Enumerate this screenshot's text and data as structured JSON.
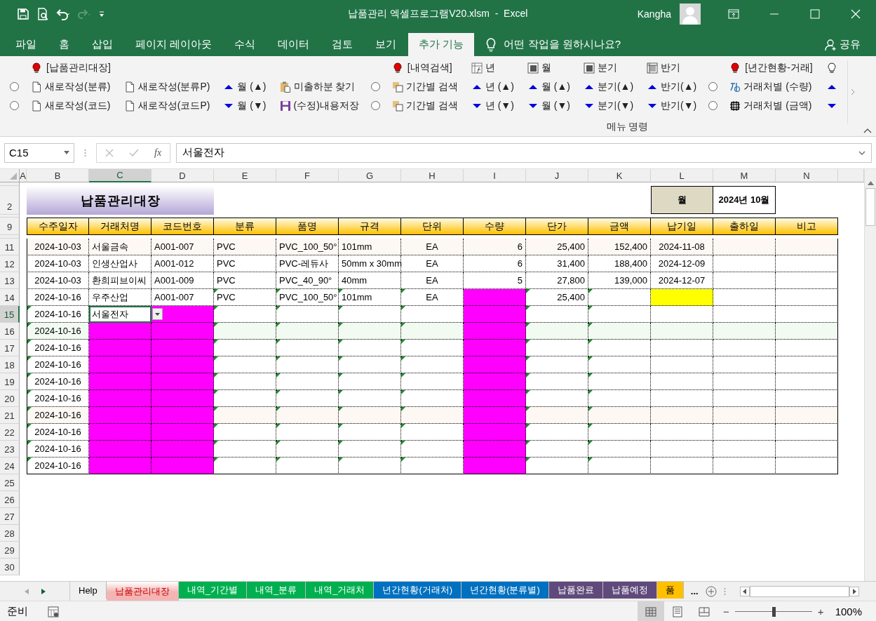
{
  "title_bar": {
    "title": "납품관리 엑셀프로그램V20.xlsm  -  Excel",
    "user": "Kangha"
  },
  "menu_tabs": [
    {
      "label": "파일",
      "selected": false
    },
    {
      "label": "홈",
      "selected": false
    },
    {
      "label": "삽입",
      "selected": false
    },
    {
      "label": "페이지 레이아웃",
      "selected": false
    },
    {
      "label": "수식",
      "selected": false
    },
    {
      "label": "데이터",
      "selected": false
    },
    {
      "label": "검토",
      "selected": false
    },
    {
      "label": "보기",
      "selected": false
    },
    {
      "label": "추가 기능",
      "selected": true
    }
  ],
  "tell_me": "어떤 작업을 원하시나요?",
  "share": "공유",
  "ribbon": {
    "columns": [
      {
        "middle": {
          "kind": "radio",
          "checked": false
        },
        "bottom": {
          "kind": "radio",
          "checked": false
        }
      },
      {
        "top": {
          "kind": "header",
          "text": "[납품관리대장]"
        },
        "middle": {
          "kind": "command",
          "text": "새로작성(분류)"
        },
        "bottom": {
          "kind": "command",
          "text": "새로작성(코드)"
        }
      },
      {
        "middle": {
          "kind": "command",
          "text": "새로작성(분류P)"
        },
        "bottom": {
          "kind": "command",
          "text": "새로작성(코드P)"
        }
      },
      {
        "middle": {
          "kind": "command",
          "text": "월 (▲)"
        },
        "bottom": {
          "kind": "command",
          "text": "월 (▼)"
        }
      },
      {
        "middle": {
          "kind": "command",
          "text": "미출하분 찾기"
        },
        "bottom": {
          "kind": "command",
          "text": "(수정)내용저장"
        }
      },
      {
        "middle": {
          "kind": "radio",
          "checked": false
        },
        "bottom": {
          "kind": "radio",
          "checked": false
        }
      },
      {
        "top": {
          "kind": "header",
          "text": "[내역검색]"
        },
        "middle": {
          "kind": "command",
          "text": "기간별 검색"
        },
        "bottom": {
          "kind": "command",
          "text": "기간별 검색"
        }
      },
      {
        "top": {
          "kind": "command",
          "text": "년"
        },
        "middle": {
          "kind": "command",
          "text": "년 (▲)"
        },
        "bottom": {
          "kind": "command",
          "text": "년 (▼)"
        }
      },
      {
        "top": {
          "kind": "command",
          "text": "월"
        },
        "middle": {
          "kind": "command",
          "text": "월 (▲)"
        },
        "bottom": {
          "kind": "command",
          "text": "월 (▼)"
        }
      },
      {
        "top": {
          "kind": "command",
          "text": "분기"
        },
        "middle": {
          "kind": "command",
          "text": "분기(▲)"
        },
        "bottom": {
          "kind": "command",
          "text": "분기(▼)"
        }
      },
      {
        "top": {
          "kind": "command",
          "text": "반기"
        },
        "middle": {
          "kind": "command",
          "text": "반기(▲)"
        },
        "bottom": {
          "kind": "command",
          "text": "반기(▼)"
        }
      },
      {
        "middle": {
          "kind": "radio",
          "checked": false
        },
        "bottom": {
          "kind": "radio",
          "checked": false
        }
      },
      {
        "top": {
          "kind": "header",
          "text": "[년간현황-거래]"
        },
        "middle": {
          "kind": "command",
          "text": "거래처별 (수량)"
        },
        "bottom": {
          "kind": "command",
          "text": "거래처별 (금액)"
        }
      },
      {
        "top": {
          "kind": "command"
        },
        "middle": {
          "kind": "command"
        },
        "bottom": {
          "kind": "command"
        }
      }
    ],
    "group_label": "메뉴 명령"
  },
  "formula_bar": {
    "name_box": "C15",
    "function_button": "fx",
    "value": "서울전자"
  },
  "sheet": {
    "column_letters": [
      {
        "label": "A",
        "selected": false
      },
      {
        "label": "B",
        "selected": false
      },
      {
        "label": "C",
        "selected": true
      },
      {
        "label": "D",
        "selected": false
      },
      {
        "label": "E",
        "selected": false
      },
      {
        "label": "F",
        "selected": false
      },
      {
        "label": "G",
        "selected": false
      },
      {
        "label": "H",
        "selected": false
      },
      {
        "label": "I",
        "selected": false
      },
      {
        "label": "J",
        "selected": false
      },
      {
        "label": "K",
        "selected": false
      },
      {
        "label": "L",
        "selected": false
      },
      {
        "label": "M",
        "selected": false
      },
      {
        "label": "N",
        "selected": false
      }
    ],
    "title_row": "2",
    "title": "납품관리대장",
    "period": {
      "label": "월",
      "value": "2024년 10월"
    },
    "header_row": "9",
    "headers": [
      "수주일자",
      "거래처명",
      "코드번호",
      "분류",
      "품명",
      "규격",
      "단위",
      "수량",
      "단가",
      "금액",
      "납기일",
      "출하일",
      "비고"
    ],
    "rows": [
      {
        "number": "11",
        "selected": false,
        "color": "#fdf8f3",
        "cells": [
          {
            "text": "2024-10-03"
          },
          {
            "text": "서울금속"
          },
          {
            "text": "A001-007"
          },
          {
            "text": "PVC"
          },
          {
            "text": "PVC_100_50°"
          },
          {
            "text": "101mm"
          },
          {
            "text": "EA"
          },
          {
            "text": "6"
          },
          {
            "text": "25,400"
          },
          {
            "text": "152,400"
          },
          {
            "text": "2024-11-08"
          },
          {},
          {}
        ]
      },
      {
        "number": "12",
        "selected": false,
        "cells": [
          {
            "text": "2024-10-03"
          },
          {
            "text": "인생산업사"
          },
          {
            "text": "A001-012"
          },
          {
            "text": "PVC"
          },
          {
            "text": "PVC-레듀사"
          },
          {
            "text": "50mm x 30mm"
          },
          {
            "text": "EA"
          },
          {
            "text": "6"
          },
          {
            "text": "31,400"
          },
          {
            "text": "188,400"
          },
          {
            "text": "2024-12-09"
          },
          {},
          {}
        ]
      },
      {
        "number": "13",
        "selected": false,
        "cells": [
          {
            "text": "2024-10-03"
          },
          {
            "text": "환희피브이씨"
          },
          {
            "text": "A001-009"
          },
          {
            "text": "PVC"
          },
          {
            "text": "PVC_40_90°"
          },
          {
            "text": "40mm"
          },
          {
            "text": "EA"
          },
          {
            "text": "5"
          },
          {
            "text": "27,800"
          },
          {
            "text": "139,000"
          },
          {
            "text": "2024-12-07"
          },
          {},
          {}
        ]
      },
      {
        "number": "14",
        "selected": false,
        "cells": [
          {
            "text": "2024-10-16"
          },
          {
            "text": "우주산업"
          },
          {
            "text": "A001-007"
          },
          {
            "text": "PVC",
            "flag": true
          },
          {
            "text": "PVC_100_50°",
            "flag": true
          },
          {
            "text": "101mm",
            "flag": true
          },
          {
            "text": "EA",
            "flag": true
          },
          {
            "color": "#ff00ff"
          },
          {
            "text": "25,400",
            "flag": true
          },
          {
            "flag": true
          },
          {
            "color": "#ffff00"
          },
          {},
          {}
        ]
      },
      {
        "number": "15",
        "selected": true,
        "cells": [
          {
            "text": "2024-10-16",
            "flag": true
          },
          {
            "text": "서울전자"
          },
          {
            "color": "#ff00ff"
          },
          {
            "flag": true
          },
          {
            "flag": true
          },
          {
            "flag": true
          },
          {
            "flag": true
          },
          {
            "color": "#ff00ff"
          },
          {
            "flag": true
          },
          {
            "flag": true
          },
          {},
          {},
          {}
        ]
      },
      {
        "number": "16",
        "selected": false,
        "color": "#f2fbf2",
        "cells": [
          {
            "text": "2024-10-16",
            "flag": true
          },
          {
            "color": "#ff00ff"
          },
          {
            "color": "#ff00ff"
          },
          {
            "flag": true
          },
          {
            "flag": true
          },
          {
            "flag": true
          },
          {
            "flag": true
          },
          {
            "color": "#ff00ff"
          },
          {
            "flag": true
          },
          {
            "flag": true
          },
          {},
          {},
          {}
        ]
      },
      {
        "number": "17",
        "selected": false,
        "cells": [
          {
            "text": "2024-10-16",
            "flag": true
          },
          {
            "color": "#ff00ff"
          },
          {
            "color": "#ff00ff"
          },
          {
            "flag": true
          },
          {
            "flag": true
          },
          {
            "flag": true
          },
          {
            "flag": true
          },
          {
            "color": "#ff00ff"
          },
          {
            "flag": true
          },
          {
            "flag": true
          },
          {},
          {},
          {}
        ]
      },
      {
        "number": "18",
        "selected": false,
        "cells": [
          {
            "text": "2024-10-16",
            "flag": true
          },
          {
            "color": "#ff00ff"
          },
          {
            "color": "#ff00ff"
          },
          {
            "flag": true
          },
          {
            "flag": true
          },
          {
            "flag": true
          },
          {
            "flag": true
          },
          {
            "color": "#ff00ff"
          },
          {
            "flag": true
          },
          {
            "flag": true
          },
          {},
          {},
          {}
        ]
      },
      {
        "number": "19",
        "selected": false,
        "cells": [
          {
            "text": "2024-10-16",
            "flag": true
          },
          {
            "color": "#ff00ff"
          },
          {
            "color": "#ff00ff"
          },
          {
            "flag": true
          },
          {
            "flag": true
          },
          {
            "flag": true
          },
          {
            "flag": true
          },
          {
            "color": "#ff00ff"
          },
          {
            "flag": true
          },
          {
            "flag": true
          },
          {},
          {},
          {}
        ]
      },
      {
        "number": "20",
        "selected": false,
        "cells": [
          {
            "text": "2024-10-16",
            "flag": true
          },
          {
            "color": "#ff00ff"
          },
          {
            "color": "#ff00ff"
          },
          {
            "flag": true
          },
          {
            "flag": true
          },
          {
            "flag": true
          },
          {
            "flag": true
          },
          {
            "color": "#ff00ff"
          },
          {
            "flag": true
          },
          {
            "flag": true
          },
          {},
          {},
          {}
        ]
      },
      {
        "number": "21",
        "selected": false,
        "color": "#fdf8f3",
        "cells": [
          {
            "text": "2024-10-16",
            "flag": true
          },
          {
            "color": "#ff00ff"
          },
          {
            "color": "#ff00ff"
          },
          {
            "flag": true
          },
          {
            "flag": true
          },
          {
            "flag": true
          },
          {
            "flag": true
          },
          {
            "color": "#ff00ff"
          },
          {
            "flag": true
          },
          {
            "flag": true
          },
          {},
          {},
          {}
        ]
      },
      {
        "number": "22",
        "selected": false,
        "cells": [
          {
            "text": "2024-10-16",
            "flag": true
          },
          {
            "color": "#ff00ff"
          },
          {
            "color": "#ff00ff"
          },
          {
            "flag": true
          },
          {
            "flag": true
          },
          {
            "flag": true
          },
          {
            "flag": true
          },
          {
            "color": "#ff00ff"
          },
          {
            "flag": true
          },
          {
            "flag": true
          },
          {},
          {},
          {}
        ]
      },
      {
        "number": "23",
        "selected": false,
        "cells": [
          {
            "text": "2024-10-16",
            "flag": true
          },
          {
            "color": "#ff00ff"
          },
          {
            "color": "#ff00ff"
          },
          {
            "flag": true
          },
          {
            "flag": true
          },
          {
            "flag": true
          },
          {
            "flag": true
          },
          {
            "color": "#ff00ff"
          },
          {
            "flag": true
          },
          {
            "flag": true
          },
          {},
          {},
          {}
        ]
      },
      {
        "number": "24",
        "selected": false,
        "cells": [
          {
            "text": "2024-10-16",
            "flag": true
          },
          {
            "color": "#ff00ff"
          },
          {
            "color": "#ff00ff"
          },
          {
            "flag": true
          },
          {
            "flag": true
          },
          {
            "flag": true
          },
          {
            "flag": true
          },
          {
            "color": "#ff00ff"
          },
          {
            "flag": true
          },
          {
            "flag": true
          },
          {},
          {},
          {}
        ]
      }
    ],
    "empty_rows": [
      "25",
      "26",
      "27",
      "28",
      "29",
      "30"
    ]
  },
  "sheet_tabs": [
    {
      "label": "Help",
      "selected": false
    },
    {
      "label": "납품관리대장",
      "selected": true,
      "color": "#f4b4b4"
    },
    {
      "label": "내역_기간별",
      "selected": false,
      "color": "#00b050"
    },
    {
      "label": "내역_분류",
      "selected": false,
      "color": "#00b050"
    },
    {
      "label": "내역_거래처",
      "selected": false,
      "color": "#00b050"
    },
    {
      "label": "년간현황(거래처)",
      "selected": false,
      "color": "#0070c0"
    },
    {
      "label": "년간현황(분류별)",
      "selected": false,
      "color": "#0070c0"
    },
    {
      "label": "납품완료",
      "selected": false,
      "color": "#604a7b"
    },
    {
      "label": "납품예정",
      "selected": false,
      "color": "#604a7b"
    },
    {
      "label": "품",
      "selected": false,
      "color": "#ffc000"
    }
  ],
  "more_tabs": "...",
  "status_bar": {
    "status": "준비",
    "views": [
      {
        "kind": "normal",
        "selected": true
      },
      {
        "kind": "page-layout",
        "selected": false
      },
      {
        "kind": "page-break",
        "selected": false
      }
    ],
    "zoom_out": "−",
    "zoom_in": "+",
    "zoom_slider": {
      "level": 0.5
    },
    "zoom": "100%"
  }
}
